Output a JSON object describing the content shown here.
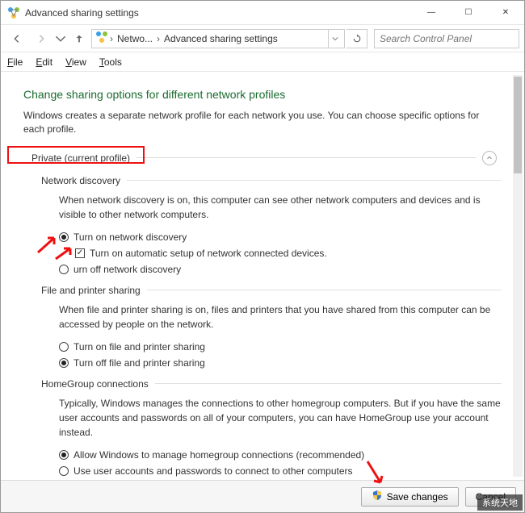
{
  "window": {
    "title": "Advanced sharing settings"
  },
  "controls": {
    "minimize": "—",
    "maximize": "☐",
    "close": "✕"
  },
  "breadcrumb": {
    "item1": "Netwo...",
    "item2": "Advanced sharing settings"
  },
  "search": {
    "placeholder": "Search Control Panel"
  },
  "menubar": {
    "file": "File",
    "edit": "Edit",
    "view": "View",
    "tools": "Tools"
  },
  "heading": "Change sharing options for different network profiles",
  "subdesc": "Windows creates a separate network profile for each network you use. You can choose specific options for each profile.",
  "profile": {
    "label": "Private (current profile)"
  },
  "netdisc": {
    "title": "Network discovery",
    "desc": "When network discovery is on, this computer can see other network computers and devices and is visible to other network computers.",
    "opt_on": "Turn on network discovery",
    "opt_auto": "Turn on automatic setup of network connected devices.",
    "opt_off": "urn off network discovery"
  },
  "fps": {
    "title": "File and printer sharing",
    "desc": "When file and printer sharing is on, files and printers that you have shared from this computer can be accessed by people on the network.",
    "opt_on": "Turn on file and printer sharing",
    "opt_off": "Turn off file and printer sharing"
  },
  "hg": {
    "title": "HomeGroup connections",
    "desc": "Typically, Windows manages the connections to other homegroup computers. But if you have the same user accounts and passwords on all of your computers, you can have HomeGroup use your account instead.",
    "opt_allow": "Allow Windows to manage homegroup connections (recommended)",
    "opt_user": "Use user accounts and passwords to connect to other computers"
  },
  "footer": {
    "save": "Save changes",
    "cancel": "Cancel"
  },
  "watermark": "系统天地"
}
